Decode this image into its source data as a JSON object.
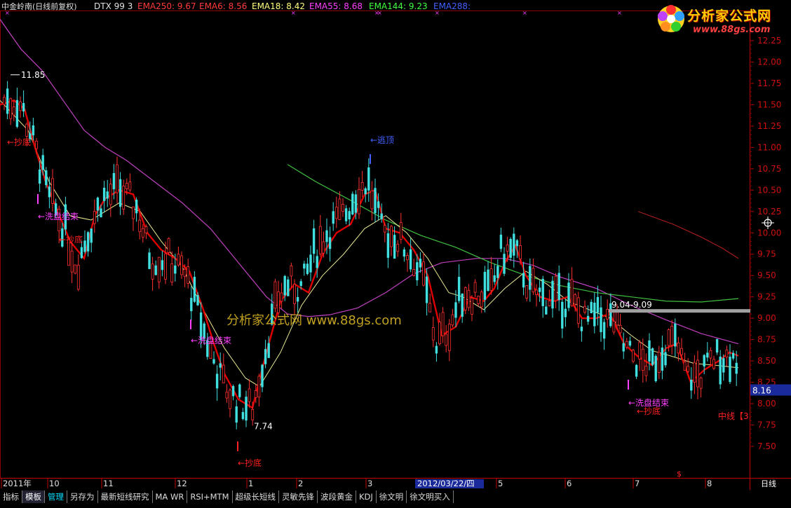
{
  "header": {
    "stock_label": "中金岭南(日线前复权)",
    "indicator": "DTX 99 3",
    "emas": [
      {
        "label": "EMA250:",
        "value": "9.67",
        "color": "#ff3b3b"
      },
      {
        "label": "EMA6:",
        "value": "8.56",
        "color": "#ff3b3b"
      },
      {
        "label": "EMA18:",
        "value": "8.42",
        "color": "#ffff80"
      },
      {
        "label": "EMA55:",
        "value": "8.68",
        "color": "#ff40ff"
      },
      {
        "label": "EMA144:",
        "value": "9.23",
        "color": "#40ff40"
      },
      {
        "label": "EMA288:",
        "value": "",
        "color": "#4060ff"
      }
    ]
  },
  "logo": {
    "title": "分析家公式网",
    "url": "www.88gs.com"
  },
  "watermark": "分析家公式网 www.88gs.com",
  "chart_data": {
    "type": "candlestick",
    "ylim": [
      7.25,
      12.3
    ],
    "y_ticks": [
      "12.25",
      "12.00",
      "11.75",
      "11.50",
      "11.25",
      "11.00",
      "10.75",
      "10.50",
      "10.25",
      "10.00",
      "9.75",
      "9.50",
      "9.25",
      "9.00",
      "8.75",
      "8.50",
      "8.25",
      "8.00",
      "7.75",
      "7.50"
    ],
    "x_labels": [
      "2011年",
      "10",
      "11",
      "12",
      "1",
      "2",
      "3",
      "2012/03/22/四",
      "5",
      "6",
      "7",
      "8"
    ],
    "annotations": [
      {
        "text": "11.85",
        "price": 11.85
      },
      {
        "text": "7.74",
        "price": 7.74
      },
      {
        "text": "9.04-9.09",
        "price": 9.09
      },
      {
        "text": "←抄底"
      },
      {
        "text": "←洗盘结束"
      },
      {
        "text": "←抄底"
      },
      {
        "text": "←洗盘结束"
      },
      {
        "text": "←抄底"
      },
      {
        "text": "←逃顶"
      },
      {
        "text": "←洗盘结束"
      },
      {
        "text": "←抄底"
      },
      {
        "text": "中线【3"
      }
    ],
    "current_price": "8.16",
    "period_label": "日线",
    "bottom_marker": "$"
  },
  "toolbar": {
    "tabs": [
      "指标",
      "模板",
      "管理",
      "另存为",
      "最新短线研究",
      "MA WR",
      "RSI+MTM",
      "超级长短线",
      "灵敏先锋",
      "波段黄金",
      "KDJ",
      "徐文明",
      "徐文明买入"
    ]
  }
}
